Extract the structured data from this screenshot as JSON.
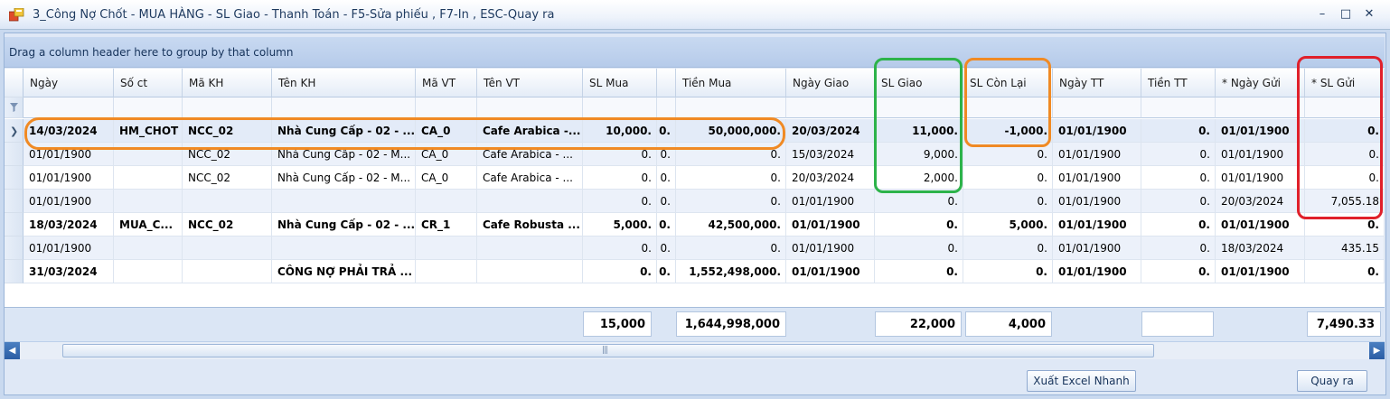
{
  "window": {
    "title": "3_Công Nợ Chốt - MUA HÀNG - SL Giao - Thanh Toán - F5-Sửa phiếu , F7-In , ESC-Quay ra",
    "minimize_glyph": "–",
    "maximize_glyph": "□",
    "close_glyph": "✕"
  },
  "group_panel": {
    "hint": "Drag a column header here to group by that column"
  },
  "columns": [
    "Ngày",
    "Số ct",
    "Mã KH",
    "Tên KH",
    "Mã VT",
    "Tên VT",
    "SL Mua",
    "",
    "Tiền Mua",
    "Ngày Giao",
    "SL Giao",
    "SL Còn Lại",
    "Ngày TT",
    "Tiền TT",
    "* Ngày Gửi",
    "* SL Gửi"
  ],
  "rows": [
    {
      "cells": [
        "14/03/2024",
        "HM_CHOT",
        "NCC_02",
        "Nhà Cung Cấp - 02 - ...",
        "CA_0",
        "Cafe Arabica -...",
        "10,000.",
        "0.",
        "50,000,000.",
        "20/03/2024",
        "11,000.",
        "-1,000.",
        "01/01/1900",
        "0.",
        "01/01/1900",
        "0."
      ],
      "bold": true,
      "focused": true
    },
    {
      "cells": [
        "01/01/1900",
        "",
        "NCC_02",
        "Nhà Cung Cấp - 02 - M...",
        "CA_0",
        "Cafe Arabica - ...",
        "0.",
        "0.",
        "0.",
        "15/03/2024",
        "9,000.",
        "0.",
        "01/01/1900",
        "0.",
        "01/01/1900",
        "0."
      ],
      "bold": false
    },
    {
      "cells": [
        "01/01/1900",
        "",
        "NCC_02",
        "Nhà Cung Cấp - 02 - M...",
        "CA_0",
        "Cafe Arabica - ...",
        "0.",
        "0.",
        "0.",
        "20/03/2024",
        "2,000.",
        "0.",
        "01/01/1900",
        "0.",
        "01/01/1900",
        "0."
      ],
      "bold": false
    },
    {
      "cells": [
        "01/01/1900",
        "",
        "",
        "",
        "",
        "",
        "0.",
        "0.",
        "0.",
        "01/01/1900",
        "0.",
        "0.",
        "01/01/1900",
        "0.",
        "20/03/2024",
        "7,055.18"
      ],
      "bold": false
    },
    {
      "cells": [
        "18/03/2024",
        "MUA_C...",
        "NCC_02",
        "Nhà Cung Cấp - 02 - ...",
        "CR_1",
        "Cafe Robusta ...",
        "5,000.",
        "0.",
        "42,500,000.",
        "01/01/1900",
        "0.",
        "5,000.",
        "01/01/1900",
        "0.",
        "01/01/1900",
        "0."
      ],
      "bold": true
    },
    {
      "cells": [
        "01/01/1900",
        "",
        "",
        "",
        "",
        "",
        "0.",
        "0.",
        "0.",
        "01/01/1900",
        "0.",
        "0.",
        "01/01/1900",
        "0.",
        "18/03/2024",
        "435.15"
      ],
      "bold": false
    },
    {
      "cells": [
        "31/03/2024",
        "",
        "",
        "CÔNG NỢ PHẢI TRẢ ...",
        "",
        "",
        "0.",
        "0.",
        "1,552,498,000.",
        "01/01/1900",
        "0.",
        "0.",
        "01/01/1900",
        "0.",
        "01/01/1900",
        "0."
      ],
      "bold": true
    }
  ],
  "totals": {
    "sl_mua": "15,000",
    "tien_mua": "1,644,998,000",
    "sl_giao": "22,000",
    "sl_con_lai": "4,000",
    "tien_tt": "",
    "sl_gui": "7,490.33"
  },
  "scrollbar": {
    "thumb_grip": "|||"
  },
  "buttons": {
    "export_excel": "Xuất Excel Nhanh",
    "back": "Quay ra"
  },
  "colors": {
    "highlight_orange": "#f08a24",
    "highlight_green": "#2db34a",
    "highlight_red": "#e0202a",
    "row_alt": "#ecf1fa",
    "focused_row": "#e3ebf8"
  }
}
